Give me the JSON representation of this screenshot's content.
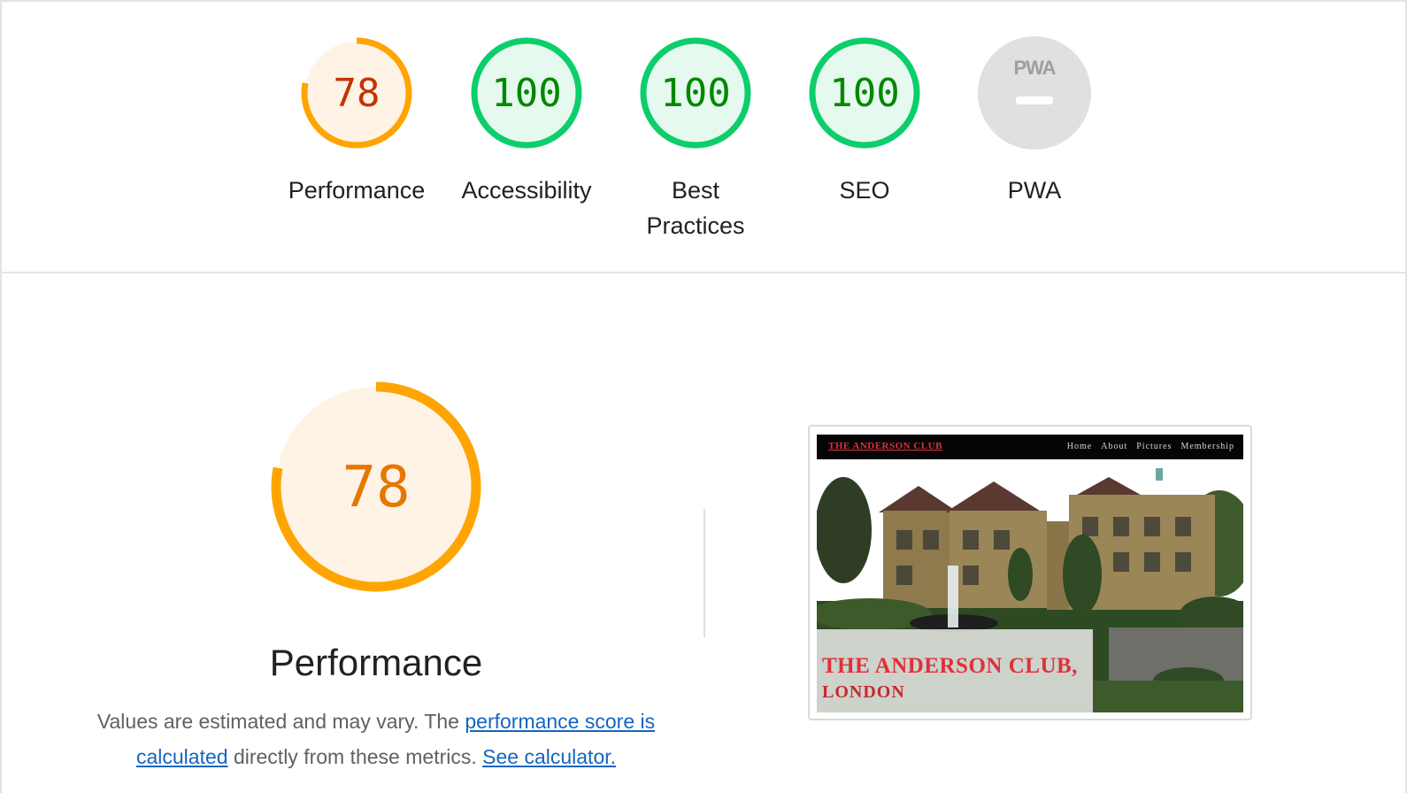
{
  "scores": [
    {
      "label": "Performance",
      "value": "78",
      "fraction": 0.78,
      "status": "average"
    },
    {
      "label": "Accessibility",
      "value": "100",
      "fraction": 1.0,
      "status": "pass"
    },
    {
      "label": "Best Practices",
      "value": "100",
      "fraction": 1.0,
      "status": "pass"
    },
    {
      "label": "SEO",
      "value": "100",
      "fraction": 1.0,
      "status": "pass"
    },
    {
      "label": "PWA",
      "value": "",
      "fraction": 0,
      "status": "na",
      "badge": "PWA"
    }
  ],
  "colors": {
    "average_stroke": "#ffa400",
    "average_text": "#c33300",
    "average_big_text": "#e67700",
    "average_fill": "#fff3e6",
    "pass_stroke": "#0cce6b",
    "pass_text": "#008800",
    "pass_fill": "#e6f9ee",
    "na_fill": "#e0e0e0",
    "na_mark": "#ffffff",
    "link": "#1565c0",
    "brand_red": "#e0303a"
  },
  "main": {
    "score": "78",
    "fraction": 0.78,
    "title": "Performance",
    "desc_prefix": "Values are estimated and may vary. The ",
    "desc_link1": "performance score is calculated",
    "desc_middle": " directly from these metrics. ",
    "desc_link2": "See calculator."
  },
  "screenshot": {
    "brand": "THE ANDERSON CLUB",
    "menu": [
      "Home",
      "About",
      "Pictures",
      "Membership"
    ],
    "hero_title": "THE ANDERSON CLUB,",
    "hero_subtitle": "LONDON"
  }
}
